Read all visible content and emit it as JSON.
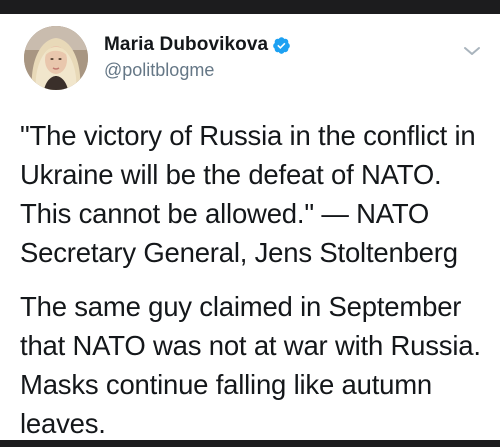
{
  "tweet": {
    "author": {
      "display_name": "Maria Dubovikova",
      "handle": "@politblogme",
      "verified": true
    },
    "paragraphs": [
      "\"The victory of Russia in the conflict in Ukraine will be the defeat of NATO. This cannot be allowed.\" — NATO Secretary General, Jens Stoltenberg",
      "The same guy claimed in September that NATO was not at war with Russia. Masks continue falling like autumn leaves."
    ]
  },
  "icons": {
    "verified": "verified-badge-icon",
    "menu": "chevron-down-icon"
  },
  "colors": {
    "text": "#14171a",
    "secondary": "#657786",
    "verified": "#1da1f2",
    "frame": "#1c1c1e"
  }
}
